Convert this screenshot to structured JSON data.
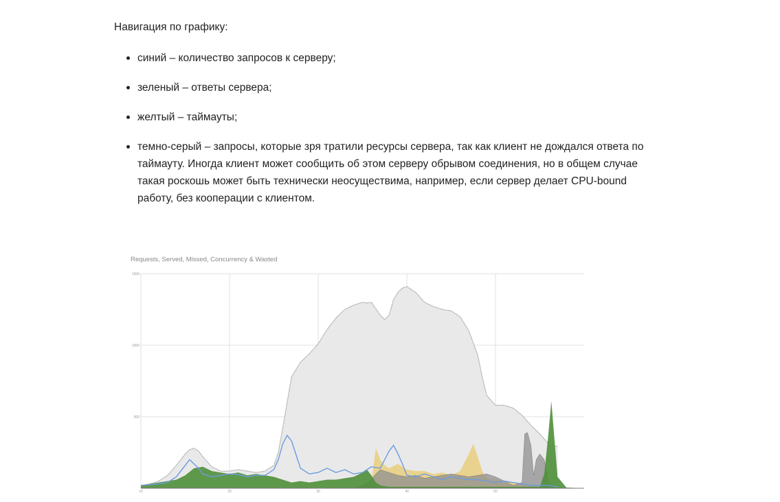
{
  "article": {
    "intro": "Навигация по графику:",
    "items": [
      "синий – количество запросов к серверу;",
      "зеленый – ответы сервера;",
      "желтый – таймауты;",
      "темно-серый – запросы, которые зря тратили ресурсы сервера, так как клиент не дождался ответа по таймауту. Иногда клиент может сообщить об этом серверу обрывом соединения, но в общем случае такая роскошь может быть технически неосуществима, например, если сервер делает CPU-bound работу, без кооперации с клиентом."
    ]
  },
  "chart_data": {
    "type": "area",
    "title": "Requests, Served, Missed, Concurrency & Wasted",
    "xlim": [
      10,
      60
    ],
    "ylim": [
      0,
      1500
    ],
    "xticks": [
      10,
      20,
      30,
      40,
      50
    ],
    "yticks": [
      500,
      1000,
      1500
    ],
    "grid": true,
    "colors": {
      "concurrency": "#e9e9e9",
      "concurrency_line": "#9a9a9a",
      "requests": "#6c9be0",
      "served": "#4f8f3a",
      "missed": "#e8c96e",
      "wasted": "#8f8f8f"
    },
    "series": [
      {
        "key": "concurrency",
        "x": [
          10,
          11,
          12,
          13,
          14,
          15,
          15.5,
          16,
          16.5,
          17,
          18,
          19,
          20,
          21,
          22,
          23,
          24,
          25,
          25.5,
          26,
          26.5,
          27,
          28,
          29,
          30,
          31,
          32,
          33,
          34,
          35,
          35.5,
          36,
          37,
          37.5,
          38,
          38.5,
          39,
          39.5,
          40,
          41,
          42,
          43,
          44,
          45,
          46,
          47,
          48,
          48.5,
          49,
          50,
          51,
          52,
          53,
          54,
          55,
          56,
          57
        ],
        "values": [
          20,
          30,
          50,
          90,
          160,
          240,
          270,
          280,
          260,
          220,
          150,
          120,
          120,
          130,
          120,
          110,
          120,
          160,
          250,
          420,
          600,
          780,
          880,
          940,
          1010,
          1110,
          1190,
          1250,
          1280,
          1300,
          1295,
          1300,
          1210,
          1180,
          1210,
          1320,
          1370,
          1400,
          1410,
          1370,
          1300,
          1270,
          1250,
          1240,
          1200,
          1100,
          930,
          780,
          650,
          580,
          580,
          560,
          510,
          440,
          380,
          310,
          290
        ]
      },
      {
        "key": "requests",
        "x": [
          10,
          11,
          12,
          13,
          14,
          15,
          15.5,
          16,
          16.5,
          17,
          18,
          19,
          20,
          21,
          22,
          23,
          24,
          25,
          25.5,
          26,
          26.5,
          27,
          28,
          29,
          30,
          31,
          32,
          33,
          34,
          35,
          36,
          37,
          37.5,
          38,
          38.5,
          39,
          39.5,
          40,
          41,
          42,
          43,
          44,
          45,
          46,
          47,
          48,
          49,
          50,
          51,
          52,
          53,
          54,
          55,
          56,
          57
        ],
        "values": [
          20,
          25,
          30,
          40,
          80,
          160,
          200,
          170,
          140,
          100,
          80,
          90,
          100,
          95,
          80,
          90,
          90,
          130,
          200,
          310,
          370,
          330,
          140,
          100,
          110,
          140,
          110,
          130,
          100,
          110,
          150,
          140,
          200,
          260,
          300,
          240,
          170,
          90,
          80,
          100,
          80,
          60,
          80,
          70,
          60,
          60,
          50,
          40,
          50,
          40,
          30,
          20,
          20,
          20,
          10
        ]
      },
      {
        "key": "missed",
        "x": [
          10,
          35,
          36,
          36.5,
          37,
          37.5,
          38,
          39,
          40,
          41,
          42,
          43,
          44,
          45,
          46,
          47,
          47.5,
          48,
          48.5,
          49,
          50,
          51,
          52,
          53,
          54,
          55,
          56,
          57
        ],
        "values": [
          0,
          0,
          40,
          280,
          200,
          160,
          140,
          170,
          130,
          120,
          120,
          100,
          110,
          90,
          120,
          240,
          310,
          220,
          120,
          70,
          60,
          50,
          40,
          30,
          20,
          10,
          0,
          0
        ]
      },
      {
        "key": "wasted",
        "x": [
          10,
          34,
          35,
          36,
          36.5,
          37,
          38,
          39,
          40,
          41,
          42,
          43,
          44,
          45,
          46,
          47,
          48,
          49,
          50,
          52,
          53,
          53.3,
          53.6,
          54,
          54.3,
          54.6,
          55,
          55.5,
          56,
          56.5,
          57
        ],
        "values": [
          0,
          0,
          20,
          60,
          100,
          130,
          110,
          90,
          80,
          90,
          70,
          80,
          90,
          100,
          90,
          80,
          90,
          100,
          80,
          20,
          40,
          380,
          390,
          300,
          90,
          200,
          240,
          200,
          40,
          10,
          0
        ]
      },
      {
        "key": "served",
        "x": [
          10,
          11,
          12,
          13,
          14,
          15,
          16,
          17,
          18,
          19,
          20,
          21,
          22,
          23,
          24,
          25,
          26,
          27,
          28,
          29,
          30,
          31,
          32,
          33,
          34,
          35,
          35.5,
          36,
          36.5,
          37,
          38,
          39,
          40,
          41,
          42,
          43,
          44,
          45,
          46,
          47,
          48,
          49,
          50,
          51,
          52,
          53,
          54,
          55,
          55.5,
          56,
          56.3,
          56.6,
          57,
          58,
          60
        ],
        "values": [
          20,
          30,
          40,
          50,
          60,
          90,
          140,
          150,
          120,
          110,
          100,
          110,
          90,
          100,
          90,
          80,
          60,
          40,
          50,
          40,
          50,
          60,
          60,
          70,
          80,
          110,
          130,
          90,
          40,
          20,
          10,
          10,
          10,
          10,
          10,
          10,
          10,
          10,
          10,
          10,
          10,
          10,
          10,
          10,
          10,
          10,
          10,
          10,
          100,
          400,
          610,
          380,
          80,
          5,
          0
        ]
      }
    ]
  }
}
